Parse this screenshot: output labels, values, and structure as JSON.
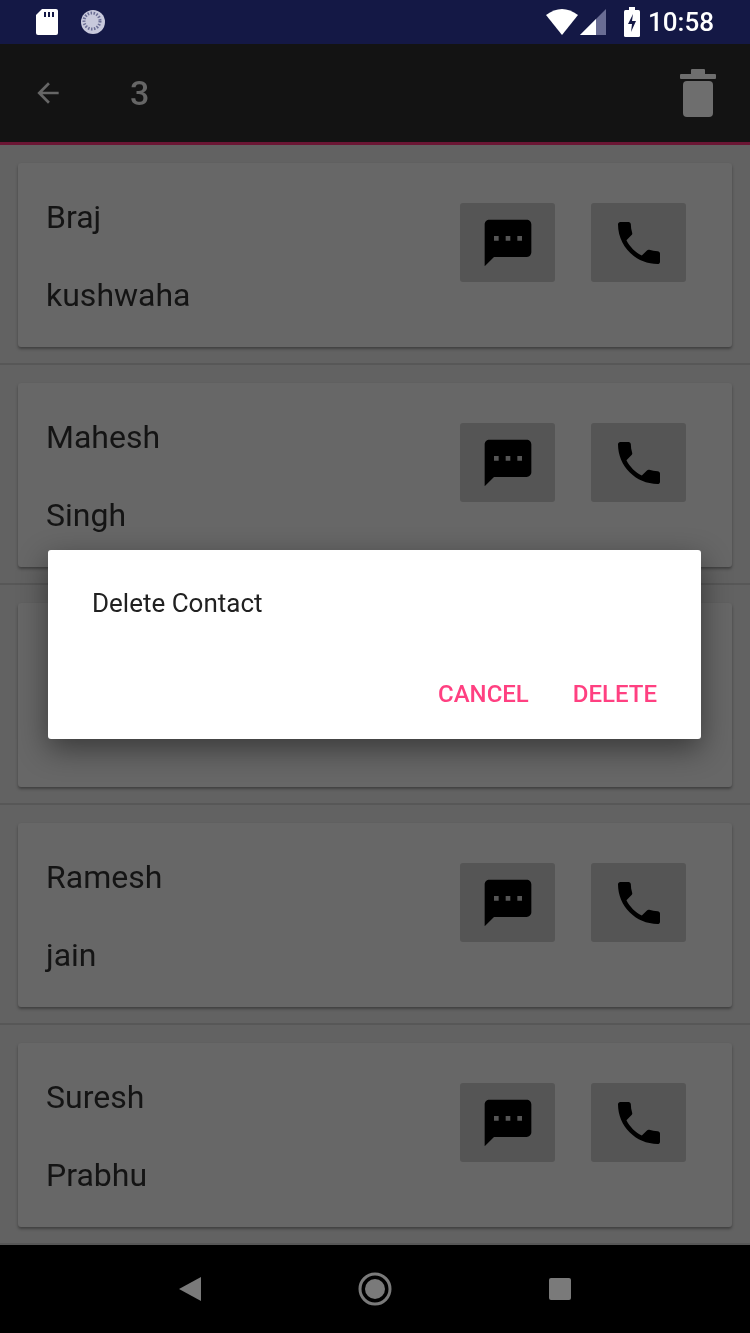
{
  "status_bar": {
    "time": "10:58"
  },
  "app_bar": {
    "title": "3"
  },
  "contacts": [
    {
      "kind": "contact",
      "first_name": "Braj",
      "last_name": "kushwaha"
    },
    {
      "kind": "contact",
      "first_name": "Mahesh",
      "last_name": "Singh"
    },
    {
      "kind": "covered"
    },
    {
      "kind": "contact",
      "first_name": "Ramesh",
      "last_name": "jain"
    },
    {
      "kind": "contact",
      "first_name": "Suresh",
      "last_name": "Prabhu"
    }
  ],
  "dialog": {
    "title": "Delete Contact",
    "buttons": [
      "CANCEL",
      "DELETE"
    ]
  }
}
